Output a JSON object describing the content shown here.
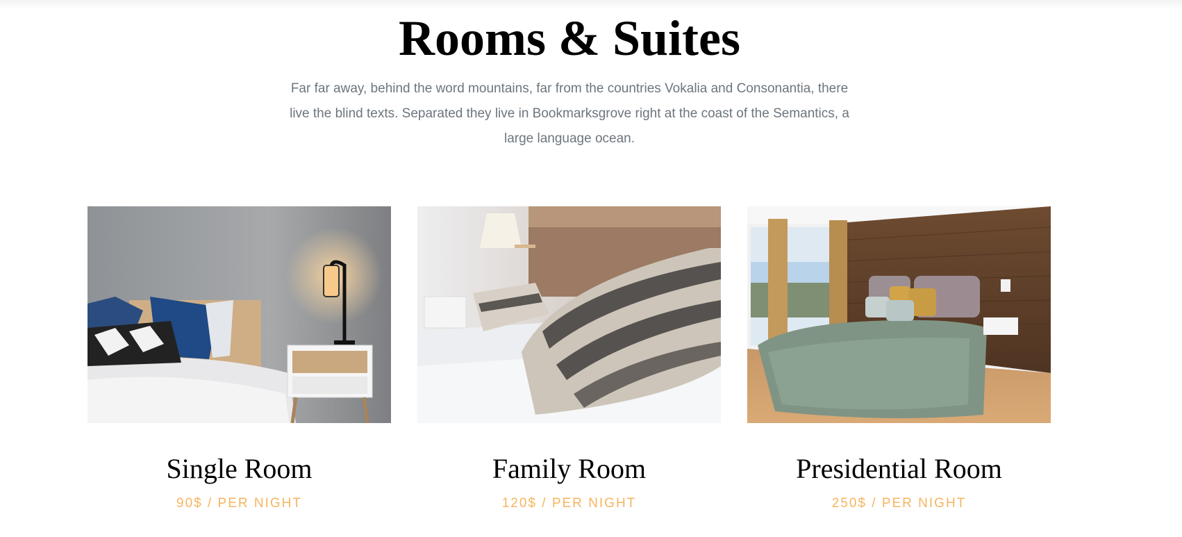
{
  "section": {
    "title": "Rooms & Suites",
    "description": "Far far away, behind the word mountains, far from the countries Vokalia and Consonantia, there live the blind texts. Separated they live in Bookmarksgrove right at the coast of the Semantics, a large language ocean."
  },
  "rooms": [
    {
      "name": "Single Room",
      "price": "90$ / PER NIGHT",
      "image": "single-room-photo"
    },
    {
      "name": "Family Room",
      "price": "120$ / PER NIGHT",
      "image": "family-room-photo"
    },
    {
      "name": "Presidential Room",
      "price": "250$ / PER NIGHT",
      "image": "presidential-room-photo"
    }
  ],
  "colors": {
    "accent": "#f6b55e",
    "muted_text": "#6c757d",
    "heading": "#000000"
  }
}
